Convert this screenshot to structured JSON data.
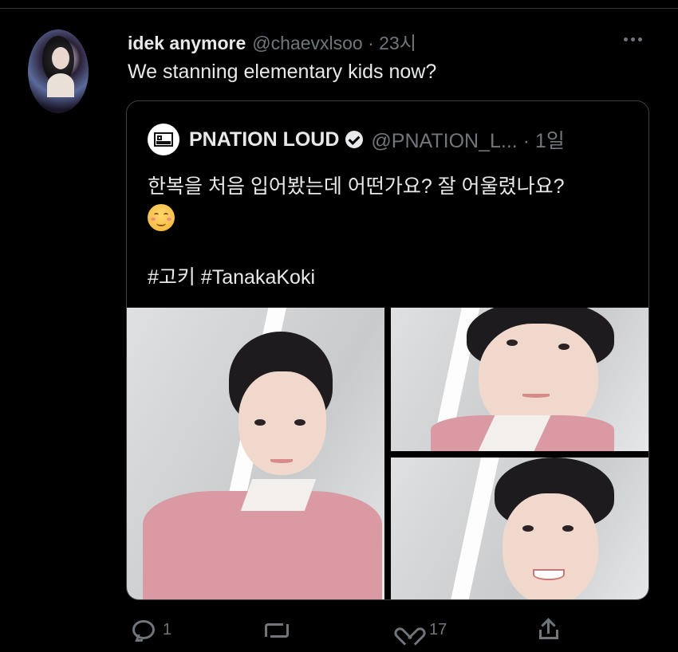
{
  "tweet": {
    "author_name": "idek anymore",
    "handle_and_time": "@chaevxlsoo · 23시",
    "text": "We stanning elementary kids now?"
  },
  "quoted_tweet": {
    "author_name": "PNATION LOUD",
    "verified": true,
    "handle_and_time": "@PNATION_L... · 1일",
    "text_line1": "한복을 처음 입어봤는데 어떤가요? 잘 어울렸나요?",
    "hashtags": "#고키 #TanakaKoki",
    "emoji_icon": "smiling-face-emoji",
    "logo_text": "PNATION",
    "photo_count": 3
  },
  "actions": {
    "reply_count": "1",
    "retweet_count": "",
    "like_count": "17",
    "share_label": ""
  },
  "colors": {
    "background": "#000000",
    "text_primary": "#e7e9ea",
    "text_secondary": "#71767b",
    "border": "#3a3f43",
    "hanbok_pink": "#d99aa3"
  }
}
